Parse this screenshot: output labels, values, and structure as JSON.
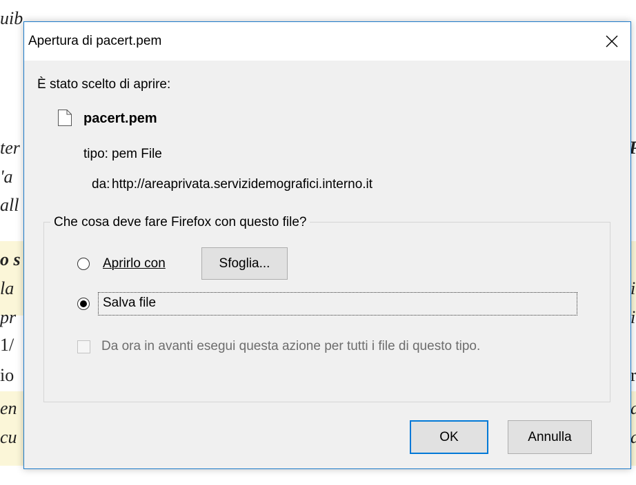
{
  "background": {
    "fragments": [
      "uib",
      "ter",
      "'a",
      "all",
      "o s",
      "la",
      "pr",
      "1/",
      "io",
      "en",
      "cu"
    ],
    "right_fragments": [
      "P",
      "i",
      "i",
      "r",
      "a",
      "a"
    ]
  },
  "dialog": {
    "title": "Apertura di pacert.pem",
    "intro": "È stato scelto di aprire:",
    "file_name": "pacert.pem",
    "type_label": "tipo:",
    "type_value": "pem File",
    "from_label": "da:",
    "from_value": "http://areaprivata.servizidemografici.interno.it",
    "group_label": "Che cosa deve fare Firefox con questo file?",
    "open_with_label": "Aprirlo con",
    "browse_label": "Sfoglia...",
    "save_label": "Salva file",
    "selected_option": "save",
    "remember_label": "Da ora in avanti esegui questa azione per tutti i file di questo tipo.",
    "ok_label": "OK",
    "cancel_label": "Annulla"
  },
  "icons": {
    "close": "close-icon",
    "file": "file-icon"
  },
  "colors": {
    "accent": "#0078d7",
    "dialog_border": "#1a79c9",
    "background_highlight": "#fbf6d8"
  }
}
